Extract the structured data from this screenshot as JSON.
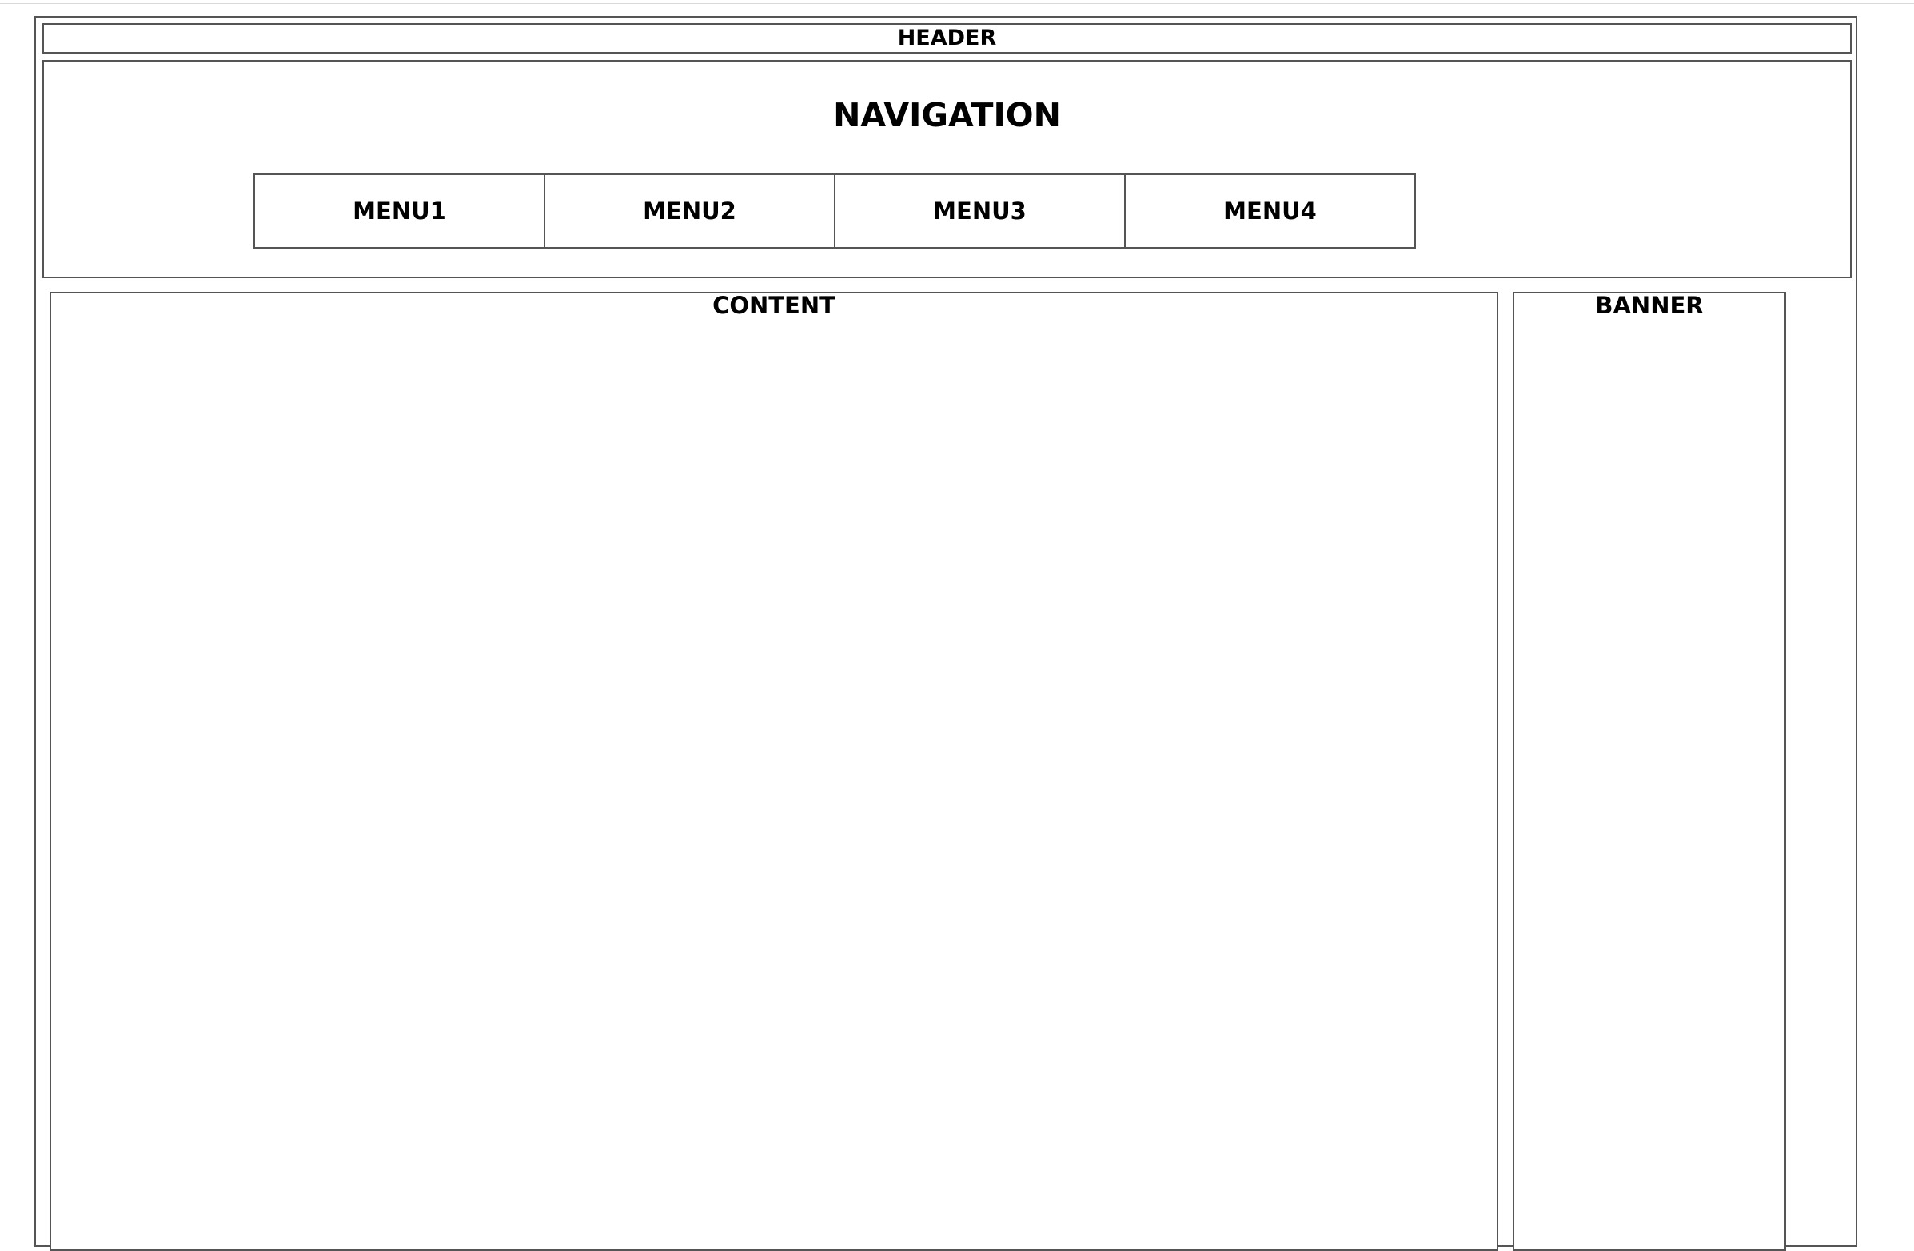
{
  "header": {
    "label": "HEADER"
  },
  "navigation": {
    "title": "NAVIGATION",
    "menu": [
      {
        "label": "MENU1"
      },
      {
        "label": "MENU2"
      },
      {
        "label": "MENU3"
      },
      {
        "label": "MENU4"
      }
    ]
  },
  "content": {
    "label": "CONTENT"
  },
  "banner": {
    "label": "BANNER"
  }
}
